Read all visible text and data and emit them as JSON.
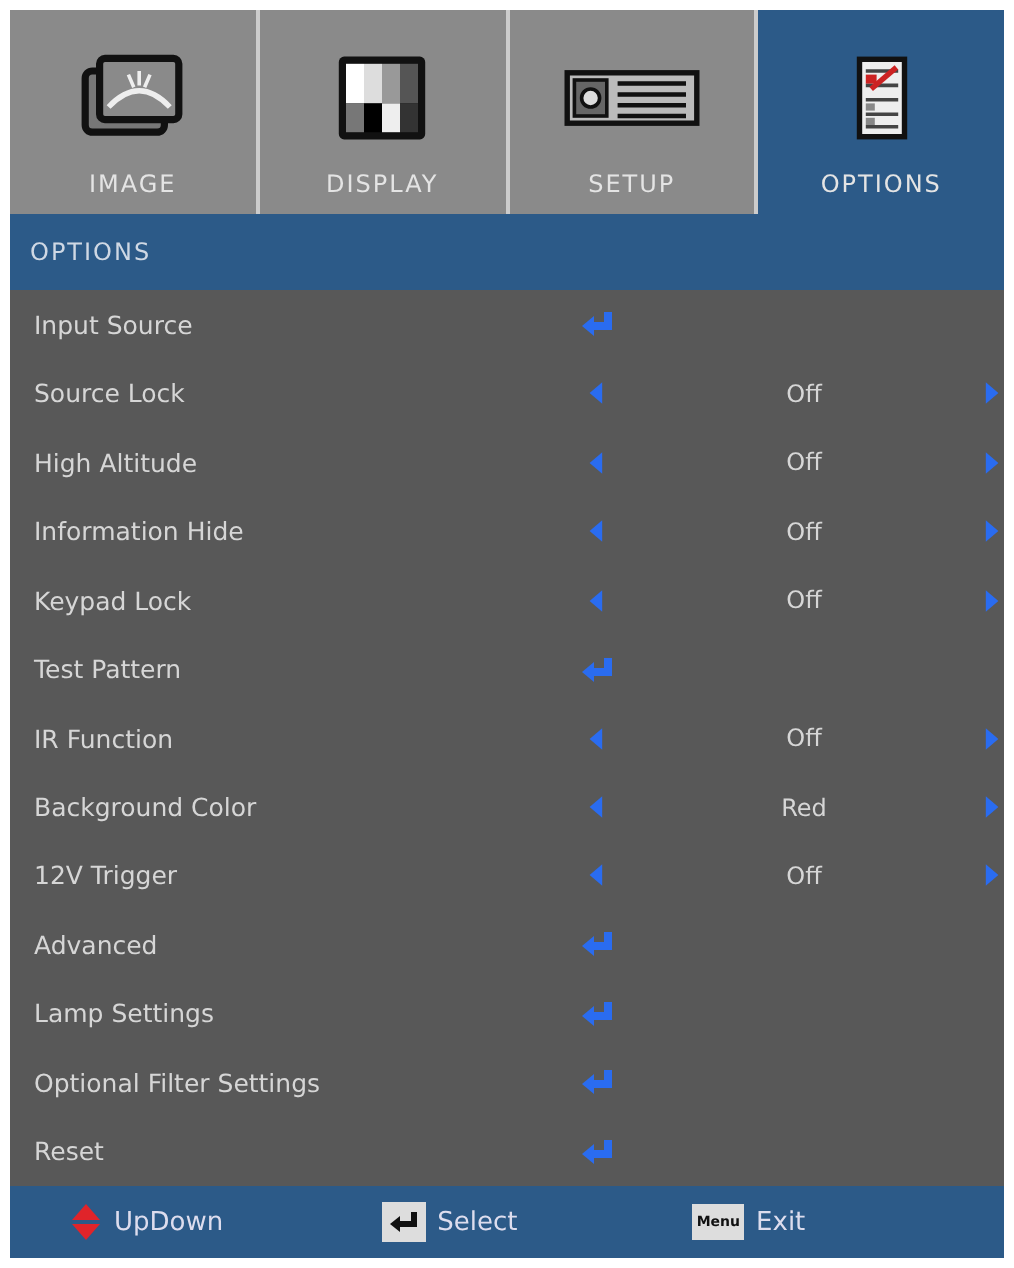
{
  "tabs": [
    {
      "label": "IMAGE",
      "kind": "image",
      "selected": false
    },
    {
      "label": "DISPLAY",
      "kind": "display",
      "selected": false
    },
    {
      "label": "SETUP",
      "kind": "setup",
      "selected": false
    },
    {
      "label": "OPTIONS",
      "kind": "options",
      "selected": true
    }
  ],
  "section_title": "OPTIONS",
  "items": [
    {
      "label": "Input Source",
      "kind": "submenu"
    },
    {
      "label": "Source Lock",
      "kind": "option",
      "value": "Off"
    },
    {
      "label": "High Altitude",
      "kind": "option",
      "value": "Off"
    },
    {
      "label": "Information Hide",
      "kind": "option",
      "value": "Off"
    },
    {
      "label": "Keypad Lock",
      "kind": "option",
      "value": "Off"
    },
    {
      "label": "Test Pattern",
      "kind": "submenu"
    },
    {
      "label": "IR Function",
      "kind": "option",
      "value": "Off"
    },
    {
      "label": "Background Color",
      "kind": "option",
      "value": "Red"
    },
    {
      "label": "12V Trigger",
      "kind": "option",
      "value": "Off"
    },
    {
      "label": "Advanced",
      "kind": "submenu"
    },
    {
      "label": "Lamp Settings",
      "kind": "submenu"
    },
    {
      "label": "Optional Filter Settings",
      "kind": "submenu"
    },
    {
      "label": "Reset",
      "kind": "submenu"
    }
  ],
  "footer": [
    {
      "kind": "updown",
      "label": "UpDown"
    },
    {
      "kind": "enter",
      "label": "Select"
    },
    {
      "kind": "menu",
      "key_text": "Menu",
      "label": "Exit"
    }
  ]
}
